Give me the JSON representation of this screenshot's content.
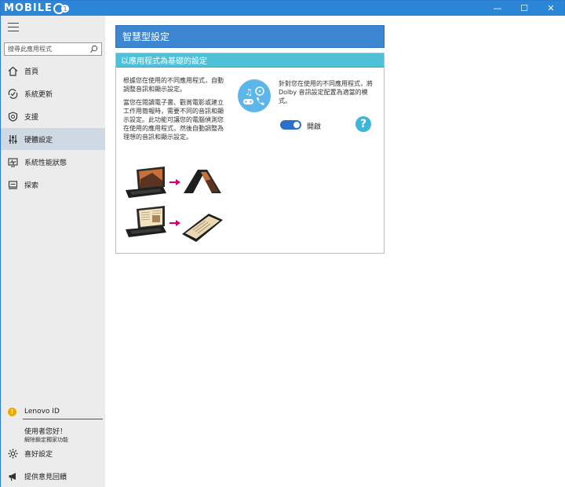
{
  "window": {
    "logo_text": "MOBILE",
    "controls": {
      "minimize": "—",
      "maximize": "☐",
      "close": "✕"
    }
  },
  "sidebar": {
    "search": {
      "placeholder": "搜尋此應用程式"
    },
    "items": [
      {
        "label": "首頁",
        "icon": "home-icon"
      },
      {
        "label": "系統更新",
        "icon": "system-update-icon"
      },
      {
        "label": "支援",
        "icon": "support-icon"
      },
      {
        "label": "硬體設定",
        "icon": "hardware-settings-icon",
        "active": true
      },
      {
        "label": "系統性能狀態",
        "icon": "system-health-icon"
      },
      {
        "label": "探索",
        "icon": "explore-icon"
      }
    ],
    "account": {
      "id_label": "Lenovo ID",
      "greeting": "使用者您好！",
      "sub": "解除鎖定獨家功能"
    },
    "preferences_label": "喜好設定",
    "feedback_label": "提供意見回饋"
  },
  "main": {
    "title": "智慧型設定",
    "card": {
      "header": "以應用程式為基礎的設定",
      "desc1": "根據您在使用的不同應用程式，自動調整音訊和顯示設定。",
      "desc2": "當您在閱讀電子書、觀賞電影或建立工作用簡報時，需要不同的音訊和顯示設定。此功能可讓您的電腦偵測您在使用的應用程式，然後自動調整為理想的音訊和顯示設定。",
      "dolby_text": "針對您在使用的不同應用程式，將 Dolby 音訊設定配置為適當的模式。",
      "toggle_label": "開啟",
      "toggle_on": true,
      "help_symbol": "?"
    }
  },
  "colors": {
    "titlebar": "#2b86d6",
    "page_title_bg": "#3d87d2",
    "card_header_bg": "#4ec1d8",
    "toggle_on": "#2f6fcc",
    "help_bg": "#3fb6d8",
    "active_nav": "#cfd9e4"
  }
}
